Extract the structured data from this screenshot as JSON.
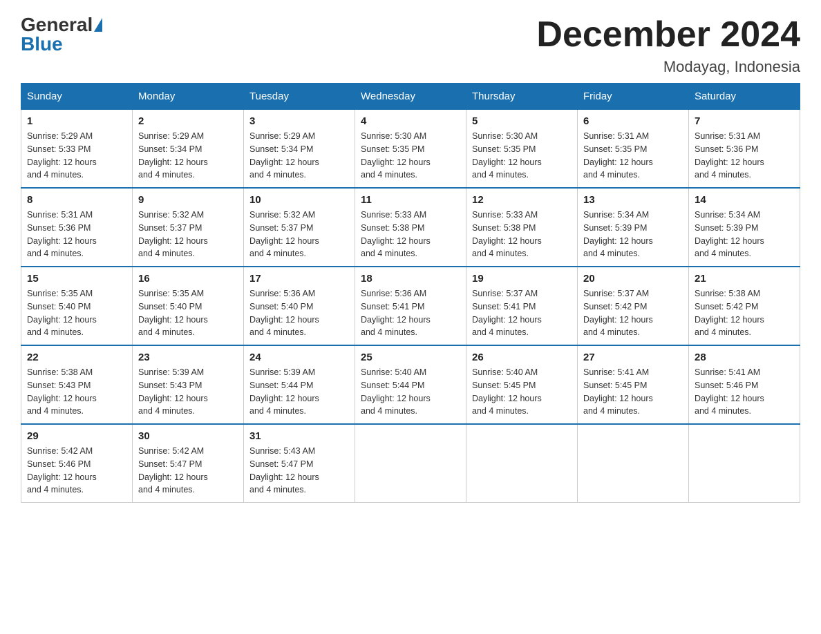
{
  "header": {
    "logo_general": "General",
    "logo_blue": "Blue",
    "title": "December 2024",
    "subtitle": "Modayag, Indonesia"
  },
  "weekdays": [
    "Sunday",
    "Monday",
    "Tuesday",
    "Wednesday",
    "Thursday",
    "Friday",
    "Saturday"
  ],
  "weeks": [
    [
      {
        "day": "1",
        "sunrise": "5:29 AM",
        "sunset": "5:33 PM",
        "daylight": "12 hours and 4 minutes."
      },
      {
        "day": "2",
        "sunrise": "5:29 AM",
        "sunset": "5:34 PM",
        "daylight": "12 hours and 4 minutes."
      },
      {
        "day": "3",
        "sunrise": "5:29 AM",
        "sunset": "5:34 PM",
        "daylight": "12 hours and 4 minutes."
      },
      {
        "day": "4",
        "sunrise": "5:30 AM",
        "sunset": "5:35 PM",
        "daylight": "12 hours and 4 minutes."
      },
      {
        "day": "5",
        "sunrise": "5:30 AM",
        "sunset": "5:35 PM",
        "daylight": "12 hours and 4 minutes."
      },
      {
        "day": "6",
        "sunrise": "5:31 AM",
        "sunset": "5:35 PM",
        "daylight": "12 hours and 4 minutes."
      },
      {
        "day": "7",
        "sunrise": "5:31 AM",
        "sunset": "5:36 PM",
        "daylight": "12 hours and 4 minutes."
      }
    ],
    [
      {
        "day": "8",
        "sunrise": "5:31 AM",
        "sunset": "5:36 PM",
        "daylight": "12 hours and 4 minutes."
      },
      {
        "day": "9",
        "sunrise": "5:32 AM",
        "sunset": "5:37 PM",
        "daylight": "12 hours and 4 minutes."
      },
      {
        "day": "10",
        "sunrise": "5:32 AM",
        "sunset": "5:37 PM",
        "daylight": "12 hours and 4 minutes."
      },
      {
        "day": "11",
        "sunrise": "5:33 AM",
        "sunset": "5:38 PM",
        "daylight": "12 hours and 4 minutes."
      },
      {
        "day": "12",
        "sunrise": "5:33 AM",
        "sunset": "5:38 PM",
        "daylight": "12 hours and 4 minutes."
      },
      {
        "day": "13",
        "sunrise": "5:34 AM",
        "sunset": "5:39 PM",
        "daylight": "12 hours and 4 minutes."
      },
      {
        "day": "14",
        "sunrise": "5:34 AM",
        "sunset": "5:39 PM",
        "daylight": "12 hours and 4 minutes."
      }
    ],
    [
      {
        "day": "15",
        "sunrise": "5:35 AM",
        "sunset": "5:40 PM",
        "daylight": "12 hours and 4 minutes."
      },
      {
        "day": "16",
        "sunrise": "5:35 AM",
        "sunset": "5:40 PM",
        "daylight": "12 hours and 4 minutes."
      },
      {
        "day": "17",
        "sunrise": "5:36 AM",
        "sunset": "5:40 PM",
        "daylight": "12 hours and 4 minutes."
      },
      {
        "day": "18",
        "sunrise": "5:36 AM",
        "sunset": "5:41 PM",
        "daylight": "12 hours and 4 minutes."
      },
      {
        "day": "19",
        "sunrise": "5:37 AM",
        "sunset": "5:41 PM",
        "daylight": "12 hours and 4 minutes."
      },
      {
        "day": "20",
        "sunrise": "5:37 AM",
        "sunset": "5:42 PM",
        "daylight": "12 hours and 4 minutes."
      },
      {
        "day": "21",
        "sunrise": "5:38 AM",
        "sunset": "5:42 PM",
        "daylight": "12 hours and 4 minutes."
      }
    ],
    [
      {
        "day": "22",
        "sunrise": "5:38 AM",
        "sunset": "5:43 PM",
        "daylight": "12 hours and 4 minutes."
      },
      {
        "day": "23",
        "sunrise": "5:39 AM",
        "sunset": "5:43 PM",
        "daylight": "12 hours and 4 minutes."
      },
      {
        "day": "24",
        "sunrise": "5:39 AM",
        "sunset": "5:44 PM",
        "daylight": "12 hours and 4 minutes."
      },
      {
        "day": "25",
        "sunrise": "5:40 AM",
        "sunset": "5:44 PM",
        "daylight": "12 hours and 4 minutes."
      },
      {
        "day": "26",
        "sunrise": "5:40 AM",
        "sunset": "5:45 PM",
        "daylight": "12 hours and 4 minutes."
      },
      {
        "day": "27",
        "sunrise": "5:41 AM",
        "sunset": "5:45 PM",
        "daylight": "12 hours and 4 minutes."
      },
      {
        "day": "28",
        "sunrise": "5:41 AM",
        "sunset": "5:46 PM",
        "daylight": "12 hours and 4 minutes."
      }
    ],
    [
      {
        "day": "29",
        "sunrise": "5:42 AM",
        "sunset": "5:46 PM",
        "daylight": "12 hours and 4 minutes."
      },
      {
        "day": "30",
        "sunrise": "5:42 AM",
        "sunset": "5:47 PM",
        "daylight": "12 hours and 4 minutes."
      },
      {
        "day": "31",
        "sunrise": "5:43 AM",
        "sunset": "5:47 PM",
        "daylight": "12 hours and 4 minutes."
      },
      null,
      null,
      null,
      null
    ]
  ],
  "labels": {
    "sunrise_prefix": "Sunrise: ",
    "sunset_prefix": "Sunset: ",
    "daylight_prefix": "Daylight: "
  }
}
